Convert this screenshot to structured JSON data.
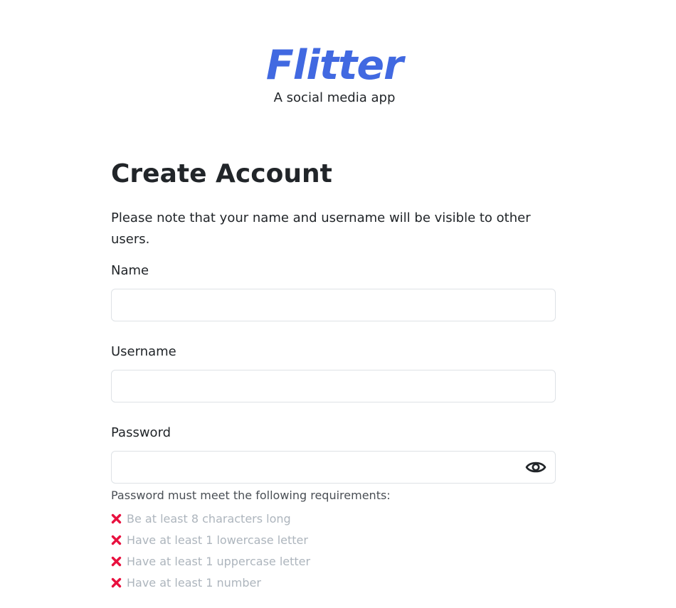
{
  "brand": {
    "title": "Flitter",
    "subtitle": "A social media app",
    "accent_color": "#4169e1"
  },
  "form": {
    "heading": "Create Account",
    "note": "Please note that your name and username will be visible to other users.",
    "name": {
      "label": "Name",
      "value": "",
      "placeholder": ""
    },
    "username": {
      "label": "Username",
      "value": "",
      "placeholder": ""
    },
    "password": {
      "label": "Password",
      "value": "",
      "placeholder": "",
      "toggle_icon": "eye-icon"
    },
    "requirements": {
      "title": "Password must meet the following requirements:",
      "status_icon": "cross-icon",
      "status_color": "#e8113f",
      "items": [
        "Be at least 8 characters long",
        "Have at least 1 lowercase letter",
        "Have at least 1 uppercase letter",
        "Have at least 1 number"
      ]
    }
  }
}
